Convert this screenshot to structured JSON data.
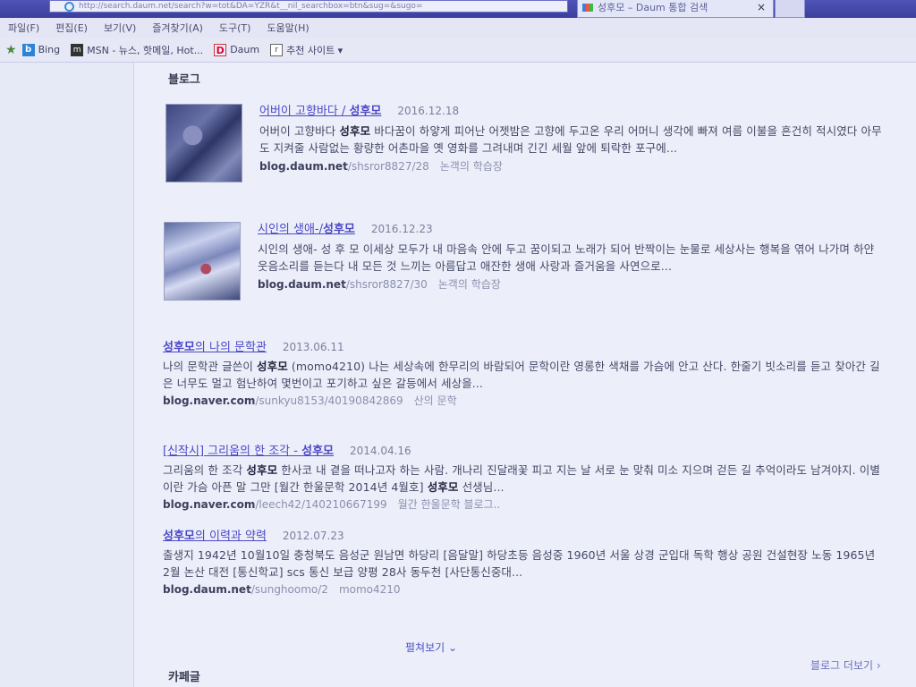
{
  "browser": {
    "address": "http://search.daum.net/search?w=tot&DA=YZR&t__nil_searchbox=btn&sug=&sugo=",
    "active_tab_title": "성후모 – Daum 통합 검색",
    "tab_close": "×"
  },
  "menu": [
    "파일(F)",
    "편집(E)",
    "보기(V)",
    "즐겨찾기(A)",
    "도구(T)",
    "도움말(H)"
  ],
  "favorites": [
    {
      "icon": "b",
      "label": "Bing"
    },
    {
      "icon": "m",
      "label": "MSN - 뉴스, 핫메일, Hot..."
    },
    {
      "icon": "D",
      "label": "Daum"
    },
    {
      "icon": "r",
      "label": "추천 사이트 ▾"
    }
  ],
  "blog_section": {
    "title": "블로그",
    "results": [
      {
        "title": "어버이 고향바다 / ",
        "title_hl": "성후모",
        "date": "2016.12.18",
        "snippet_pre": "어버이 고향바다 ",
        "snippet_hl": "성후모",
        "snippet_post": " 바다꿈이 하얗게 피어난 어젯밤은 고향에 두고온 우리 어머니 생각에 빠져 여름 이불을 흔건히 적시였다 아무도 지켜줄 사람없는 황량한 어촌마을 옛 영화를 그려내며 긴긴 세월 앞에 퇴락한 포구에...",
        "domain": "blog.daum.net",
        "path": "/shsror8827/28",
        "source": "논객의 학습장"
      },
      {
        "title": "시인의 생애-/",
        "title_hl": "성후모",
        "date": "2016.12.23",
        "snippet_pre": "시인의 생애- 성 후 모 이세상 모두가 내 마음속 안에 두고 꿈이되고 노래가 되어 반짝이는 눈물로 세상사는 행복을 엮어 나가며 하얀 웃음소리를 듣는다 내 모든 것 느끼는 아름답고 애잔한 생애 사랑과 즐거움을 사연으로...",
        "domain": "blog.daum.net",
        "path": "/shsror8827/30",
        "source": "논객의 학습장"
      },
      {
        "title_hl": "성후모",
        "title": "의 나의 문학관",
        "date": "2013.06.11",
        "snippet_pre": "나의 문학관 글쓴이 ",
        "snippet_hl": "성후모",
        "snippet_post": " (momo4210) 나는 세상속에 한무리의 바람되어 문학이란 영롱한 색채를 가슴에 안고 산다. 한줄기 빗소리를 듣고 찾아간 길은 너무도 멀고 험난하여 몇번이고 포기하고 싶은 갈등에서 세상을...",
        "domain": "blog.naver.com",
        "path": "/sunkyu8153/40190842869",
        "source": "산의 문학"
      },
      {
        "title": "[신작시] 그리움의 한 조각 - ",
        "title_hl": "성후모",
        "date": "2014.04.16",
        "snippet_pre": "그리움의 한 조각 ",
        "snippet_hl": "성후모",
        "snippet_post": " 한사코 내 곁을 떠나고자 하는 사람. 개나리 진달래꽃 피고 지는 날 서로 눈 맞춰 미소 지으며 걷든 길 추억이라도 남겨야지. 이별이란 가슴 아픈 말 그만 [월간 한울문학 2014년 4월호] ",
        "snippet_hl2": "성후모",
        "snippet_post2": " 선생님...",
        "domain": "blog.naver.com",
        "path": "/leech42/140210667199",
        "source": "월간 한울문학 블로그.."
      },
      {
        "title_hl": "성후모",
        "title": "의 이력과 약력",
        "date": "2012.07.23",
        "snippet_pre": "출생지 1942년 10월10일 충청북도 음성군 원남면 하당리 [음달말] 하당초등 음성중 1960년 서울 상경 군입대 독학 행상 공원 건설현장 노동 1965년 2월 논산 대전 [통신학교] scs 통신 보급 양평 28사 동두천 [사단통신중대...",
        "domain": "blog.daum.net",
        "path": "/sunghoomo/2",
        "source": "momo4210"
      }
    ],
    "expand_label": "펼쳐보기 ⌄",
    "more_label": "블로그 더보기 ›"
  },
  "cafe_section": {
    "title": "카페글"
  }
}
